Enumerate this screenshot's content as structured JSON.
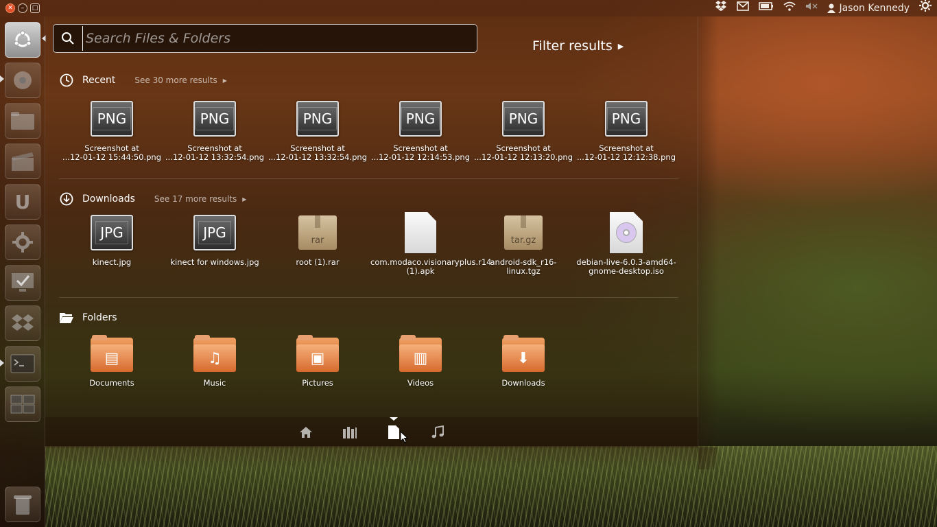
{
  "top_panel": {
    "user_name": "Jason Kennedy",
    "window_controls": [
      "close",
      "minimize",
      "maximize"
    ],
    "indicators": [
      "dropbox-icon",
      "mail-icon",
      "battery-icon",
      "wifi-icon",
      "volume-muted-icon",
      "user-icon",
      "gear-icon"
    ]
  },
  "launcher": {
    "items": [
      "ubuntu-logo",
      "chromium",
      "files",
      "videos",
      "ubuntu-one",
      "system-settings",
      "system-monitor",
      "dropbox",
      "terminal",
      "workspaces",
      "trash"
    ]
  },
  "search": {
    "placeholder": "Search Files & Folders",
    "value": ""
  },
  "filter": {
    "label": "Filter results"
  },
  "recent": {
    "title": "Recent",
    "see_more": "See 30 more results",
    "items": [
      {
        "badge": "PNG",
        "line1": "Screenshot at",
        "line2": "...12-01-12 15:44:50.png"
      },
      {
        "badge": "PNG",
        "line1": "Screenshot at",
        "line2": "...12-01-12 13:32:54.png"
      },
      {
        "badge": "PNG",
        "line1": "Screenshot at",
        "line2": "...12-01-12 13:32:54.png"
      },
      {
        "badge": "PNG",
        "line1": "Screenshot at",
        "line2": "...12-01-12 12:14:53.png"
      },
      {
        "badge": "PNG",
        "line1": "Screenshot at",
        "line2": "...12-01-12 12:13:20.png"
      },
      {
        "badge": "PNG",
        "line1": "Screenshot at",
        "line2": "...12-01-12 12:12:38.png"
      }
    ]
  },
  "downloads": {
    "title": "Downloads",
    "see_more": "See 17 more results",
    "items": [
      {
        "badge": "JPG",
        "label": "kinect.jpg"
      },
      {
        "badge": "JPG",
        "label": "kinect for windows.jpg"
      },
      {
        "badge": "rar",
        "label": "root (1).rar"
      },
      {
        "badge": "",
        "label": "com.modaco.visionaryplus.r14 (1).apk"
      },
      {
        "badge": "tar.gz",
        "label": "android-sdk_r16-linux.tgz"
      },
      {
        "badge": "",
        "label": "debian-live-6.0.3-amd64-gnome-desktop.iso"
      }
    ]
  },
  "folders": {
    "title": "Folders",
    "items": [
      {
        "label": "Documents"
      },
      {
        "label": "Music"
      },
      {
        "label": "Pictures"
      },
      {
        "label": "Videos"
      },
      {
        "label": "Downloads"
      }
    ]
  },
  "lenses": [
    "home-icon",
    "applications-icon",
    "files-icon",
    "music-icon"
  ],
  "active_lens": "files-icon"
}
